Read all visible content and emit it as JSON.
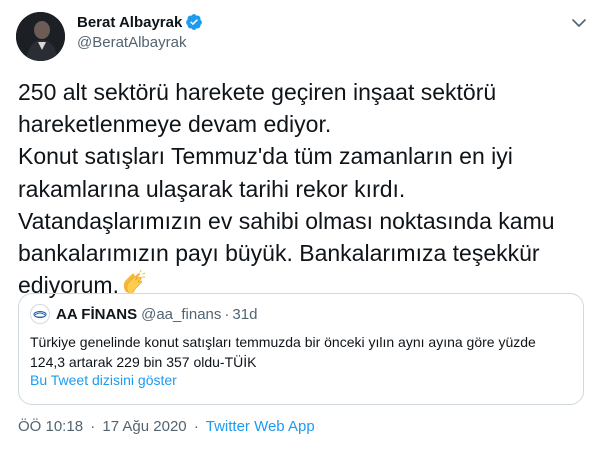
{
  "author": {
    "display_name": "Berat Albayrak",
    "handle": "@BeratAlbayrak",
    "verified": true,
    "verified_color": "#1d9bf0"
  },
  "tweet": {
    "text_lines": [
      "250 alt sektörü harekete geçiren inşaat sektörü",
      "hareketlenmeye devam ediyor.",
      "Konut satışları Temmuz'da tüm zamanların en iyi",
      "rakamlarına ulaşarak tarihi rekor kırdı.",
      "Vatandaşlarımızın ev sahibi olması noktasında kamu",
      "bankalarımızın payı büyük. Bankalarımıza teşekkür",
      "ediyorum."
    ],
    "emoji": "clapping-hands-icon"
  },
  "quote": {
    "name": "AA FİNANS",
    "handle": "@aa_finans",
    "dot": "·",
    "time": "31d",
    "text_lines": [
      "Türkiye genelinde konut satışları temmuzda bir önceki yılın aynı ayına göre yüzde",
      "124,3 artarak 229 bin 357 oldu-TÜİK"
    ],
    "show_thread": "Bu Tweet dizisini göster"
  },
  "meta": {
    "time": "ÖÖ 10:18",
    "sep": "·",
    "date": "17 Ağu 2020",
    "sep2": "·",
    "app": "Twitter Web App"
  },
  "colors": {
    "accent": "#1d9bf0",
    "muted": "#536471",
    "text": "#0f1419",
    "border": "#cfd9de"
  }
}
